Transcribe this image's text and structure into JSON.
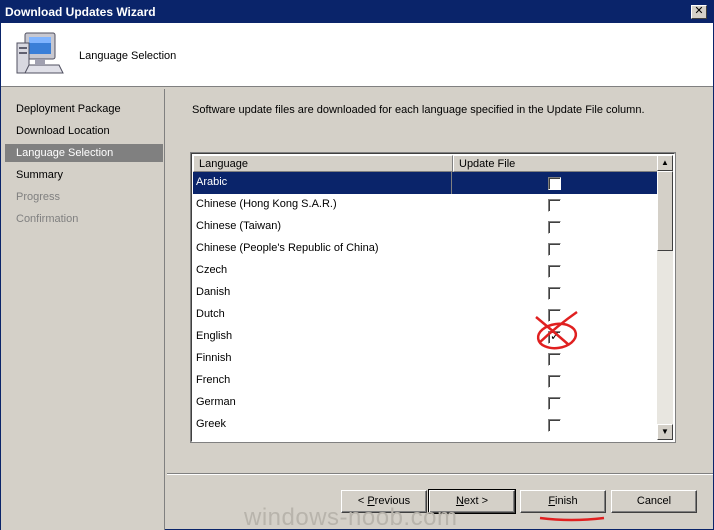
{
  "window": {
    "title": "Download Updates Wizard",
    "close_label": "✕"
  },
  "header": {
    "title": "Language Selection"
  },
  "sidebar": {
    "items": [
      {
        "label": "Deployment Package",
        "state": "normal"
      },
      {
        "label": "Download Location",
        "state": "normal"
      },
      {
        "label": "Language Selection",
        "state": "active"
      },
      {
        "label": "Summary",
        "state": "normal"
      },
      {
        "label": "Progress",
        "state": "disabled"
      },
      {
        "label": "Confirmation",
        "state": "disabled"
      }
    ]
  },
  "main": {
    "description": "Software update files are downloaded for each language specified in the Update File column.",
    "columns": [
      "Language",
      "Update File"
    ],
    "rows": [
      {
        "language": "Arabic",
        "checked": false,
        "selected": true
      },
      {
        "language": "Chinese (Hong Kong S.A.R.)",
        "checked": false
      },
      {
        "language": "Chinese (Taiwan)",
        "checked": false
      },
      {
        "language": "Chinese (People's Republic of China)",
        "checked": false
      },
      {
        "language": "Czech",
        "checked": false
      },
      {
        "language": "Danish",
        "checked": false
      },
      {
        "language": "Dutch",
        "checked": false
      },
      {
        "language": "English",
        "checked": true
      },
      {
        "language": "Finnish",
        "checked": false
      },
      {
        "language": "French",
        "checked": false
      },
      {
        "language": "German",
        "checked": false
      },
      {
        "language": "Greek",
        "checked": false
      }
    ]
  },
  "buttons": {
    "previous": {
      "prefix": "< ",
      "accel": "P",
      "rest": "revious"
    },
    "next": {
      "accel": "N",
      "rest": "ext >"
    },
    "finish": {
      "accel": "F",
      "rest": "inish"
    },
    "cancel": "Cancel"
  },
  "watermark": "windows-noob.com",
  "colors": {
    "titlebar": "#0a246a",
    "selection": "#0a246a",
    "annotation": "#e02020"
  }
}
